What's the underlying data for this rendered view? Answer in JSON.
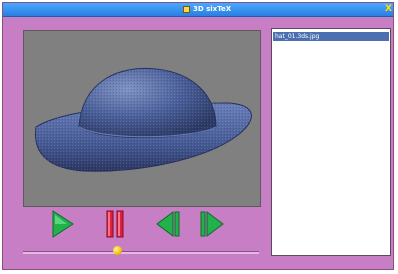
{
  "window": {
    "title": "3D sixTeX",
    "corner_glyph": "X"
  },
  "viewport": {
    "object": "hat-3d-model"
  },
  "files": {
    "items": [
      "hat_01.3ds.jpg"
    ]
  },
  "controls": {
    "play_icon": "play-icon",
    "pause_icon": "pause-icon",
    "prev_icon": "step-back-icon",
    "next_icon": "step-forward-icon"
  },
  "timeline": {
    "position": 0.4
  },
  "colors": {
    "window_bg": "#c77ec4",
    "titlebar": "#2a7fe0",
    "accent_green": "#22b14c",
    "accent_red": "#e01f3d",
    "thumb": "#f3c200"
  }
}
